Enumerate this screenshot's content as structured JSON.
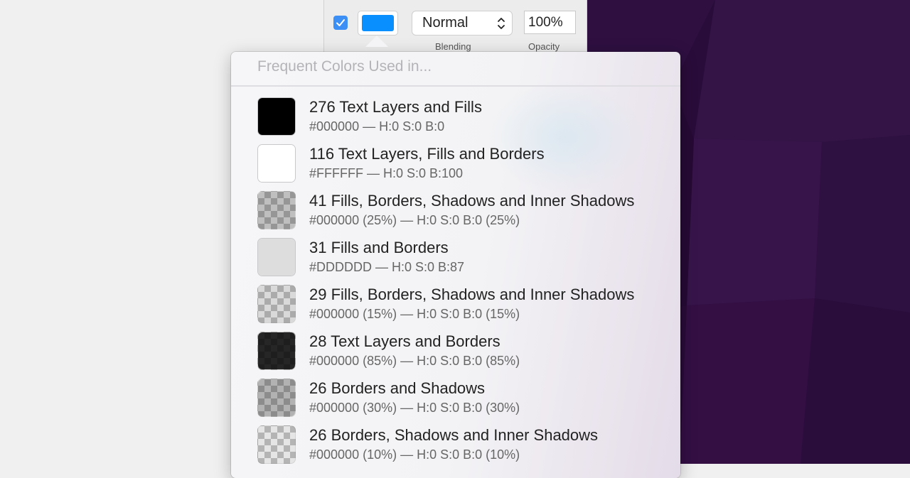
{
  "inspector": {
    "blend_mode": "Normal",
    "opacity": "100%",
    "blending_label": "Blending",
    "opacity_label": "Opacity",
    "fill_enabled": true,
    "fill_color": "#0A8FFF"
  },
  "popover": {
    "header": "Frequent Colors Used in...",
    "colors": [
      {
        "title": "276 Text Layers and Fills",
        "meta": "#000000 — H:0 S:0 B:0",
        "color": "#000000",
        "alpha": 1
      },
      {
        "title": "116 Text Layers, Fills and Borders",
        "meta": "#FFFFFF — H:0 S:0 B:100",
        "color": "#FFFFFF",
        "alpha": 1
      },
      {
        "title": "41 Fills, Borders, Shadows and Inner Shadows",
        "meta": "#000000 (25%) — H:0 S:0 B:0 (25%)",
        "color": "#000000",
        "alpha": 0.25
      },
      {
        "title": "31 Fills and Borders",
        "meta": "#DDDDDD — H:0 S:0 B:87",
        "color": "#DDDDDD",
        "alpha": 1
      },
      {
        "title": "29 Fills, Borders, Shadows and Inner Shadows",
        "meta": "#000000 (15%) — H:0 S:0 B:0 (15%)",
        "color": "#000000",
        "alpha": 0.15
      },
      {
        "title": "28 Text Layers and Borders",
        "meta": "#000000 (85%) — H:0 S:0 B:0 (85%)",
        "color": "#000000",
        "alpha": 0.85
      },
      {
        "title": "26 Borders and Shadows",
        "meta": "#000000 (30%) — H:0 S:0 B:0 (30%)",
        "color": "#000000",
        "alpha": 0.3
      },
      {
        "title": "26 Borders, Shadows and Inner Shadows",
        "meta": "#000000 (10%) — H:0 S:0 B:0 (10%)",
        "color": "#000000",
        "alpha": 0.1
      }
    ]
  }
}
